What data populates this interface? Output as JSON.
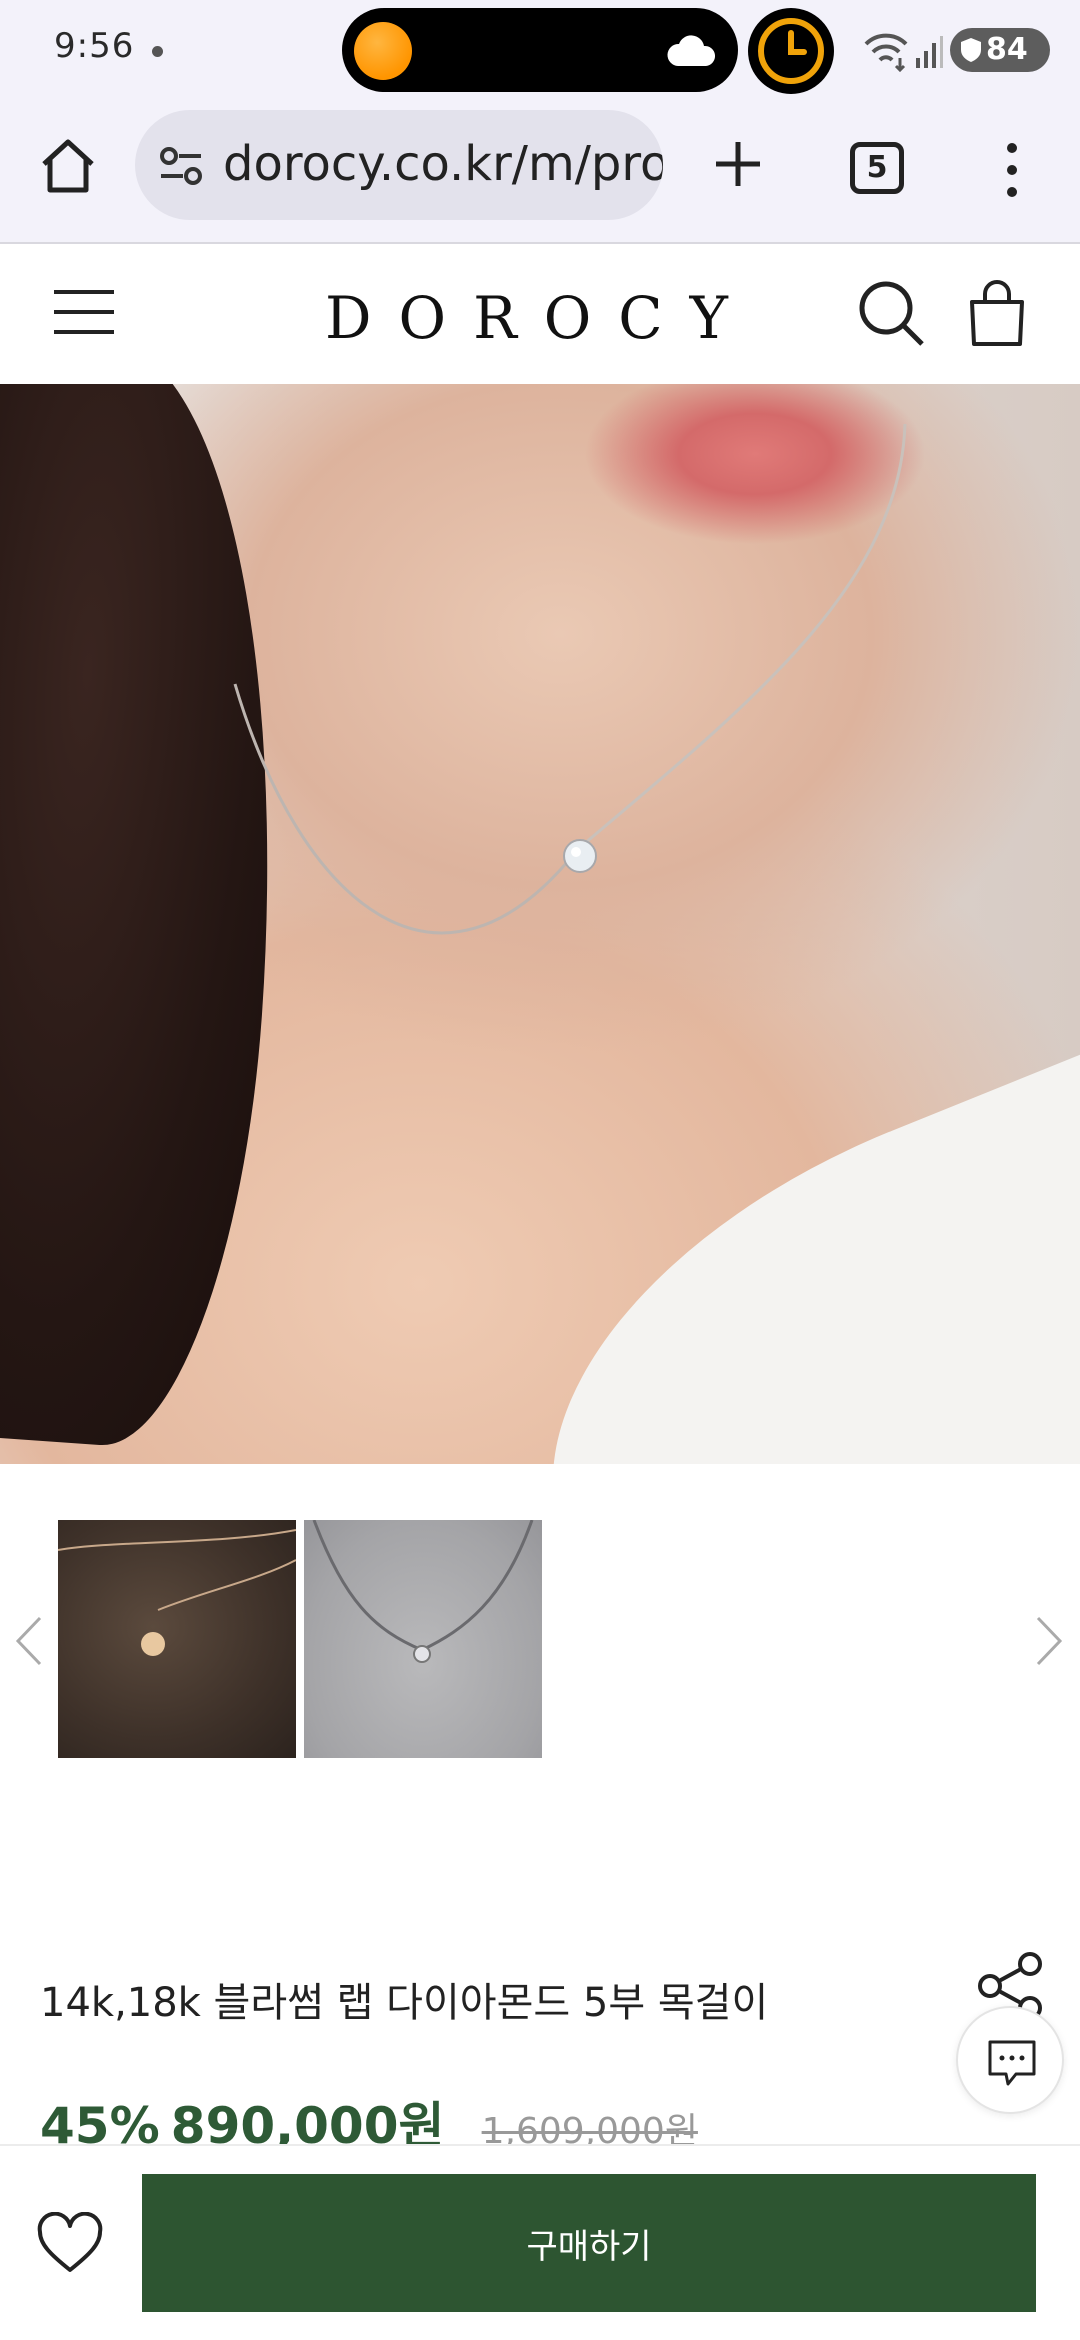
{
  "status_bar": {
    "time": "9:56",
    "battery": "84"
  },
  "browser": {
    "url": "dorocy.co.kr/m/pro",
    "tab_count": "5"
  },
  "site": {
    "logo": "DOROCY"
  },
  "product": {
    "title": "14k,18k 블라썸 랩 다이아몬드 5부 목걸이",
    "discount": "45%",
    "price": "890,000원",
    "original_price": "1,609,000원"
  },
  "bottom_bar": {
    "buy_label": "구매하기"
  },
  "colors": {
    "accent": "#2d5531",
    "price_green": "#2e5a36"
  },
  "icons": {
    "home": "home-icon",
    "site_info": "tune-icon",
    "new_tab": "plus-icon",
    "tabs": "tab-switcher-icon",
    "menu": "more-vert-icon",
    "hamburger": "hamburger-icon",
    "search": "search-icon",
    "bag": "shopping-bag-icon",
    "share": "share-icon",
    "chat": "chat-icon",
    "wishlist": "heart-icon"
  }
}
